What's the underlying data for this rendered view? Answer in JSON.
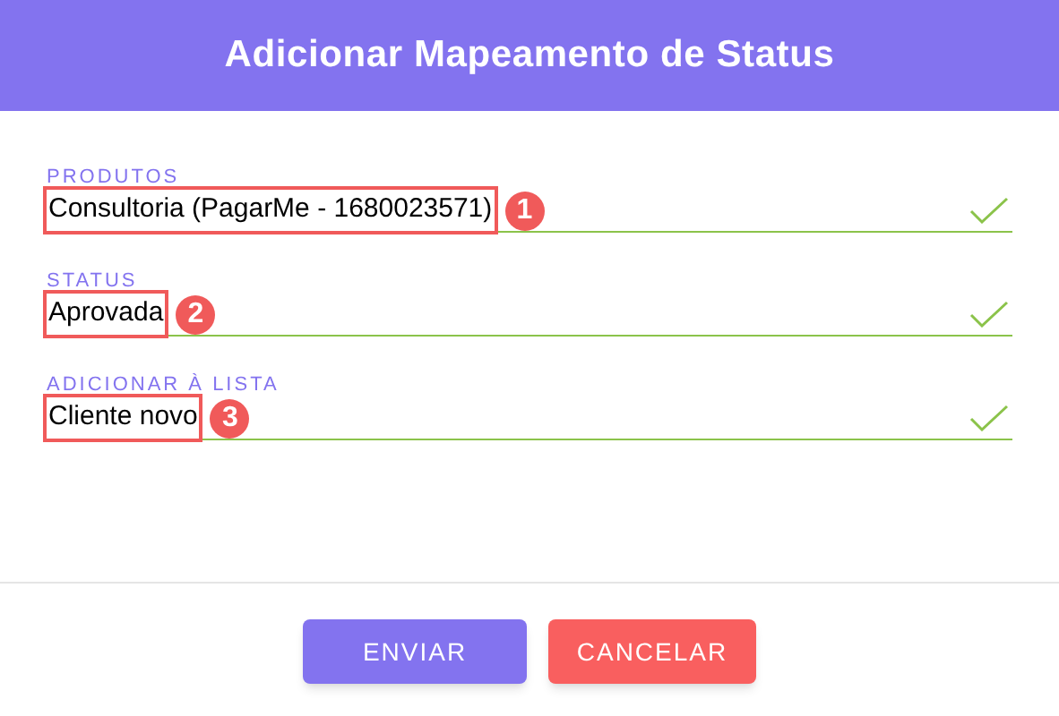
{
  "dialog": {
    "title": "Adicionar Mapeamento de Status"
  },
  "fields": [
    {
      "label": "PRODUTOS",
      "value": "Consultoria (PagarMe - 1680023571)",
      "valid": true,
      "marker": "1"
    },
    {
      "label": "STATUS",
      "value": "Aprovada",
      "valid": true,
      "marker": "2"
    },
    {
      "label": "ADICIONAR À LISTA",
      "value": "Cliente novo",
      "valid": true,
      "marker": "3"
    }
  ],
  "buttons": [
    {
      "label": "ENVIAR",
      "kind": "primary"
    },
    {
      "label": "CANCELAR",
      "kind": "danger"
    }
  ]
}
